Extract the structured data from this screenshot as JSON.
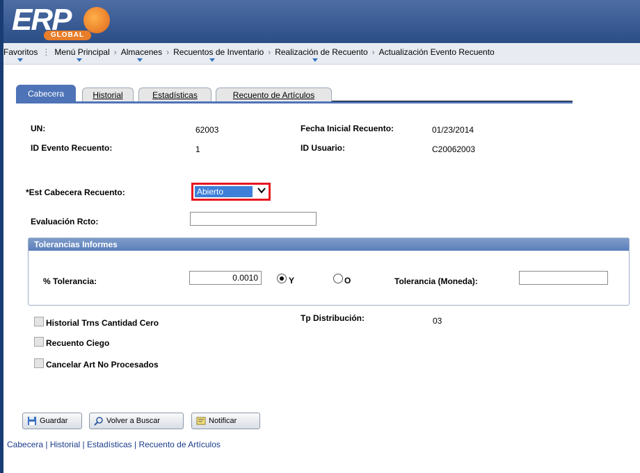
{
  "brand": {
    "logo_text": "ERP",
    "logo_sub": "GLOBAL"
  },
  "breadcrumbs": [
    "Favoritos",
    "Menú Principal",
    "Almacenes",
    "Recuentos de Inventario",
    "Realización de Recuento",
    "Actualización Evento Recuento"
  ],
  "tabs": [
    {
      "label": "Cabecera"
    },
    {
      "label": "Historial"
    },
    {
      "label": "Estadísticas"
    },
    {
      "label": "Recuento de Artículos"
    }
  ],
  "fields": {
    "un_label": "UN:",
    "un_value": "62003",
    "fecha_label": "Fecha Inicial Recuento:",
    "fecha_value": "01/23/2014",
    "evento_label": "ID Evento Recuento:",
    "evento_value": "1",
    "usuario_label": "ID Usuario:",
    "usuario_value": "C20062003",
    "estado_label": "*Est Cabecera Recuento:",
    "estado_value": "Abierto",
    "evaluacion_label": "Evaluación Rcto:",
    "evaluacion_value": ""
  },
  "tolerancias": {
    "title": "Tolerancias Informes",
    "pct_label": "% Tolerancia:",
    "pct_value": "0.0010",
    "radio_y": "Y",
    "radio_o": "O",
    "moneda_label": "Tolerancia (Moneda):",
    "moneda_value": ""
  },
  "options": {
    "historial_label": "Historial Trns Cantidad Cero",
    "ciego_label": "Recuento Ciego",
    "cancelar_label": "Cancelar Art No Procesados",
    "tp_label": "Tp Distribución:",
    "tp_value": "03"
  },
  "buttons": {
    "guardar": "Guardar",
    "volver": "Volver a Buscar",
    "notificar": "Notificar"
  },
  "footer_links": [
    "Cabecera",
    "Historial",
    "Estadísticas",
    "Recuento de Artículos"
  ],
  "colors": {
    "accent": "#4e73b7",
    "highlight_border": "#e8161f",
    "selected": "#3d7fd9"
  }
}
